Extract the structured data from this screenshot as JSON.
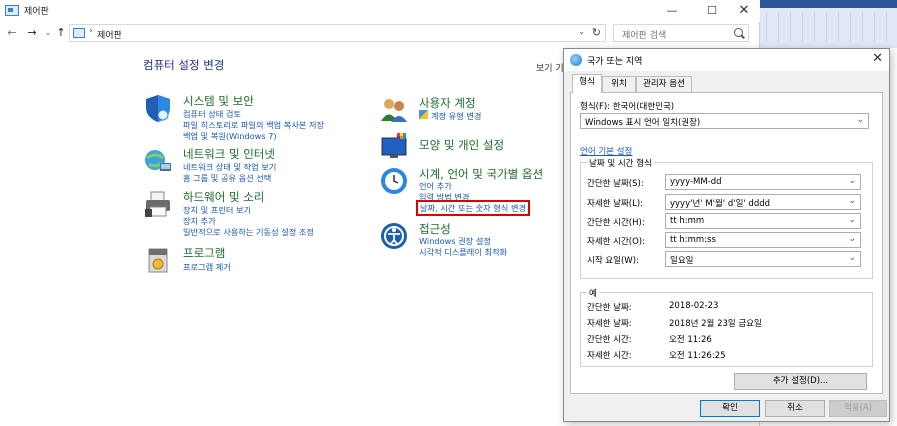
{
  "window": {
    "title": "제어판",
    "min": "—",
    "max": "☐",
    "close": "✕"
  },
  "nav": {
    "back": "←",
    "forward": "→",
    "recent": "⌄",
    "up": "↑"
  },
  "address": {
    "separator": "›",
    "crumb": "제어판",
    "refresh": "↻",
    "dropdown": "⌄"
  },
  "search": {
    "placeholder": "제어판 검색"
  },
  "main": {
    "heading": "컴퓨터 설정 변경",
    "view_by": "보기 기"
  },
  "categories": [
    {
      "icon": "shield-icon",
      "title": "시스템 및 보안",
      "links": [
        "컴퓨터 상태 검토",
        "파일 히스토리로 파일의 백업 복사본 저장",
        "백업 및 복원(Windows 7)"
      ]
    },
    {
      "icon": "network-icon",
      "title": "네트워크 및 인터넷",
      "links": [
        "네트워크 상태 및 작업 보기",
        "홈 그룹 및 공유 옵션 선택"
      ]
    },
    {
      "icon": "printer-icon",
      "title": "하드웨어 및 소리",
      "links": [
        "장치 및 프린터 보기",
        "장치 추가",
        "일반적으로 사용하는 기동성 설정 조정"
      ]
    },
    {
      "icon": "programs-icon",
      "title": "프로그램",
      "links": [
        "프로그램 제거"
      ]
    },
    {
      "icon": "users-icon",
      "title": "사용자 계정",
      "links": [
        "계정 유형 변경"
      ]
    },
    {
      "icon": "appearance-icon",
      "title": "모양 및 개인 설정",
      "links": []
    },
    {
      "icon": "clock-globe-icon",
      "title": "시계, 언어 및 국가별 옵션",
      "links": [
        "언어 추가",
        "입력 방법 변경",
        "날짜, 시간 또는 숫자 형식 변경"
      ]
    },
    {
      "icon": "ease-of-access-icon",
      "title": "접근성",
      "links": [
        "Windows 권장 설정",
        "시각적 디스플레이 최적화"
      ]
    }
  ],
  "dialog": {
    "title": "국가 또는 지역",
    "close": "✕",
    "tabs": [
      "형식",
      "위치",
      "관리자 옵션"
    ],
    "format_label": "형식(F): 한국어(대한민국)",
    "format_value": "Windows 표시 언어 일치(권장)",
    "language_pref_link": "언어 기본 설정",
    "datetime_group": "날짜 및 시간 형식",
    "fields": [
      {
        "label": "간단한 날짜(S):",
        "value": "yyyy-MM-dd"
      },
      {
        "label": "자세한 날짜(L):",
        "value": "yyyy'년' M'월' d'일' dddd"
      },
      {
        "label": "간단한 시간(H):",
        "value": "tt h:mm"
      },
      {
        "label": "자세한 시간(O):",
        "value": "tt h:mm:ss"
      },
      {
        "label": "시작 요일(W):",
        "value": "일요일"
      }
    ],
    "examples_group": "예",
    "examples": [
      {
        "label": "간단한 날짜:",
        "value": "2018-02-23"
      },
      {
        "label": "자세한 날짜:",
        "value": "2018년 2월 23일 금요일"
      },
      {
        "label": "간단한 시간:",
        "value": "오전 11:26"
      },
      {
        "label": "자세한 시간:",
        "value": "오전 11:26:25"
      }
    ],
    "additional_settings": "추가 설정(D)...",
    "ok": "확인",
    "cancel": "취소",
    "apply": "적용(A)"
  }
}
